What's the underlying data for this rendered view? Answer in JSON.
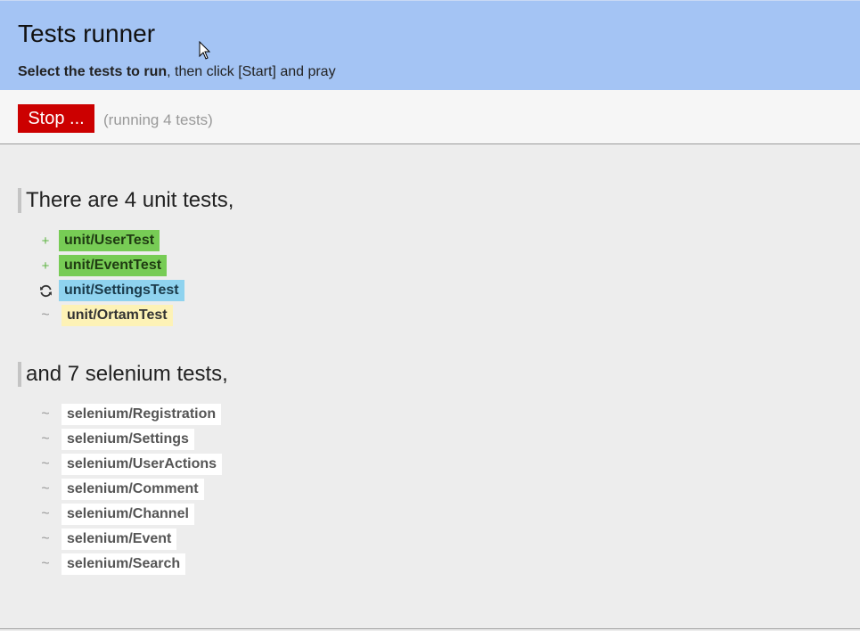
{
  "header": {
    "title": "Tests runner",
    "subtitle_bold": "Select the tests to run",
    "subtitle_rest": ", then click [Start] and pray"
  },
  "toolbar": {
    "stop_label": "Stop ...",
    "status": "(running 4 tests)"
  },
  "unit_section": {
    "heading": "There are 4 unit tests,",
    "tests": [
      {
        "name": "unit/UserTest",
        "state": "passed",
        "marker": "+"
      },
      {
        "name": "unit/EventTest",
        "state": "passed",
        "marker": "+"
      },
      {
        "name": "unit/SettingsTest",
        "state": "running",
        "marker": "refresh-icon"
      },
      {
        "name": "unit/OrtamTest",
        "state": "pending",
        "marker": "~"
      }
    ]
  },
  "selenium_section": {
    "heading": "and 7 selenium tests,",
    "tests": [
      {
        "name": "selenium/Registration",
        "state": "pending",
        "marker": "~"
      },
      {
        "name": "selenium/Settings",
        "state": "pending",
        "marker": "~"
      },
      {
        "name": "selenium/UserActions",
        "state": "pending",
        "marker": "~"
      },
      {
        "name": "selenium/Comment",
        "state": "pending",
        "marker": "~"
      },
      {
        "name": "selenium/Channel",
        "state": "pending",
        "marker": "~"
      },
      {
        "name": "selenium/Event",
        "state": "pending",
        "marker": "~"
      },
      {
        "name": "selenium/Search",
        "state": "pending",
        "marker": "~"
      }
    ]
  },
  "colors": {
    "header_bg": "#a4c4f4",
    "stop_button": "#cc0000",
    "passed": "#77cc55",
    "running": "#8fd3ef",
    "pending_unit": "#fdf2b6"
  }
}
